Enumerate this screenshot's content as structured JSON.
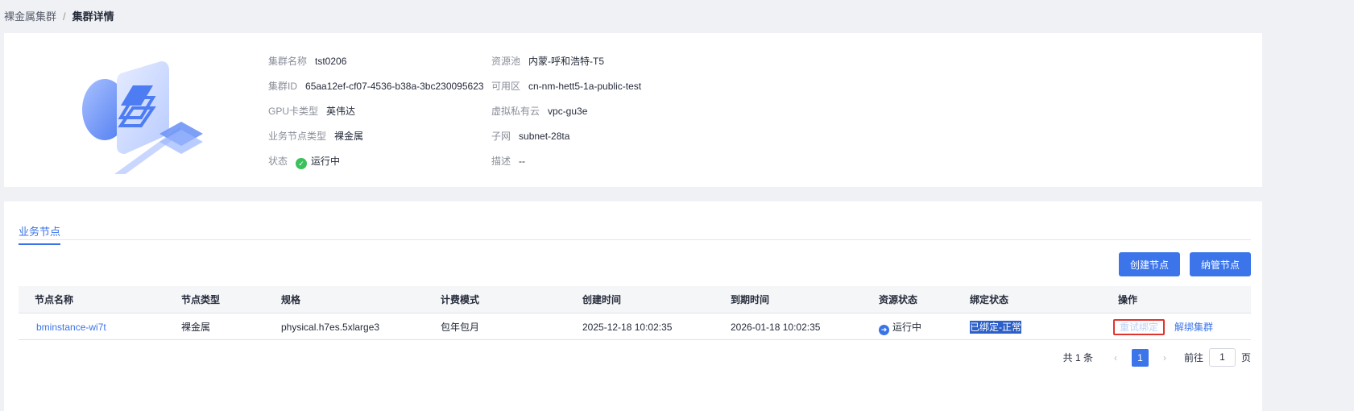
{
  "breadcrumb": {
    "parent": "裸金属集群",
    "separator": "/",
    "current": "集群详情"
  },
  "info": {
    "name": {
      "label": "集群名称",
      "value": "tst0206"
    },
    "id": {
      "label": "集群ID",
      "value": "65aa12ef-cf07-4536-b38a-3bc230095623"
    },
    "gpu": {
      "label": "GPU卡类型",
      "value": "英伟达"
    },
    "node_type": {
      "label": "业务节点类型",
      "value": "裸金属"
    },
    "status": {
      "label": "状态",
      "value": "运行中"
    },
    "pool": {
      "label": "资源池",
      "value": "内蒙-呼和浩特-T5"
    },
    "az": {
      "label": "可用区",
      "value": "cn-nm-hett5-1a-public-test"
    },
    "vpc": {
      "label": "虚拟私有云",
      "value": "vpc-gu3e"
    },
    "subnet": {
      "label": "子网",
      "value": "subnet-28ta"
    },
    "desc": {
      "label": "描述",
      "value": "--"
    }
  },
  "tab": "业务节点",
  "buttons": {
    "create": "创建节点",
    "manage": "纳管节点"
  },
  "table": {
    "headers": [
      "节点名称",
      "节点类型",
      "规格",
      "计费模式",
      "创建时间",
      "到期时间",
      "资源状态",
      "绑定状态",
      "操作"
    ],
    "rows": [
      {
        "name": "bminstance-wi7t",
        "type": "裸金属",
        "spec": "physical.h7es.5xlarge3",
        "billing": "包年包月",
        "created": "2025-12-18 10:02:35",
        "expires": "2026-01-18 10:02:35",
        "resource_status": "运行中",
        "bind_status": "已绑定-正常",
        "actions": [
          "重试绑定",
          "解绑集群"
        ]
      }
    ]
  },
  "pagination": {
    "total": "共 1 条",
    "current": "1",
    "goto_label": "前往",
    "goto_value": "1",
    "page_suffix": "页"
  }
}
